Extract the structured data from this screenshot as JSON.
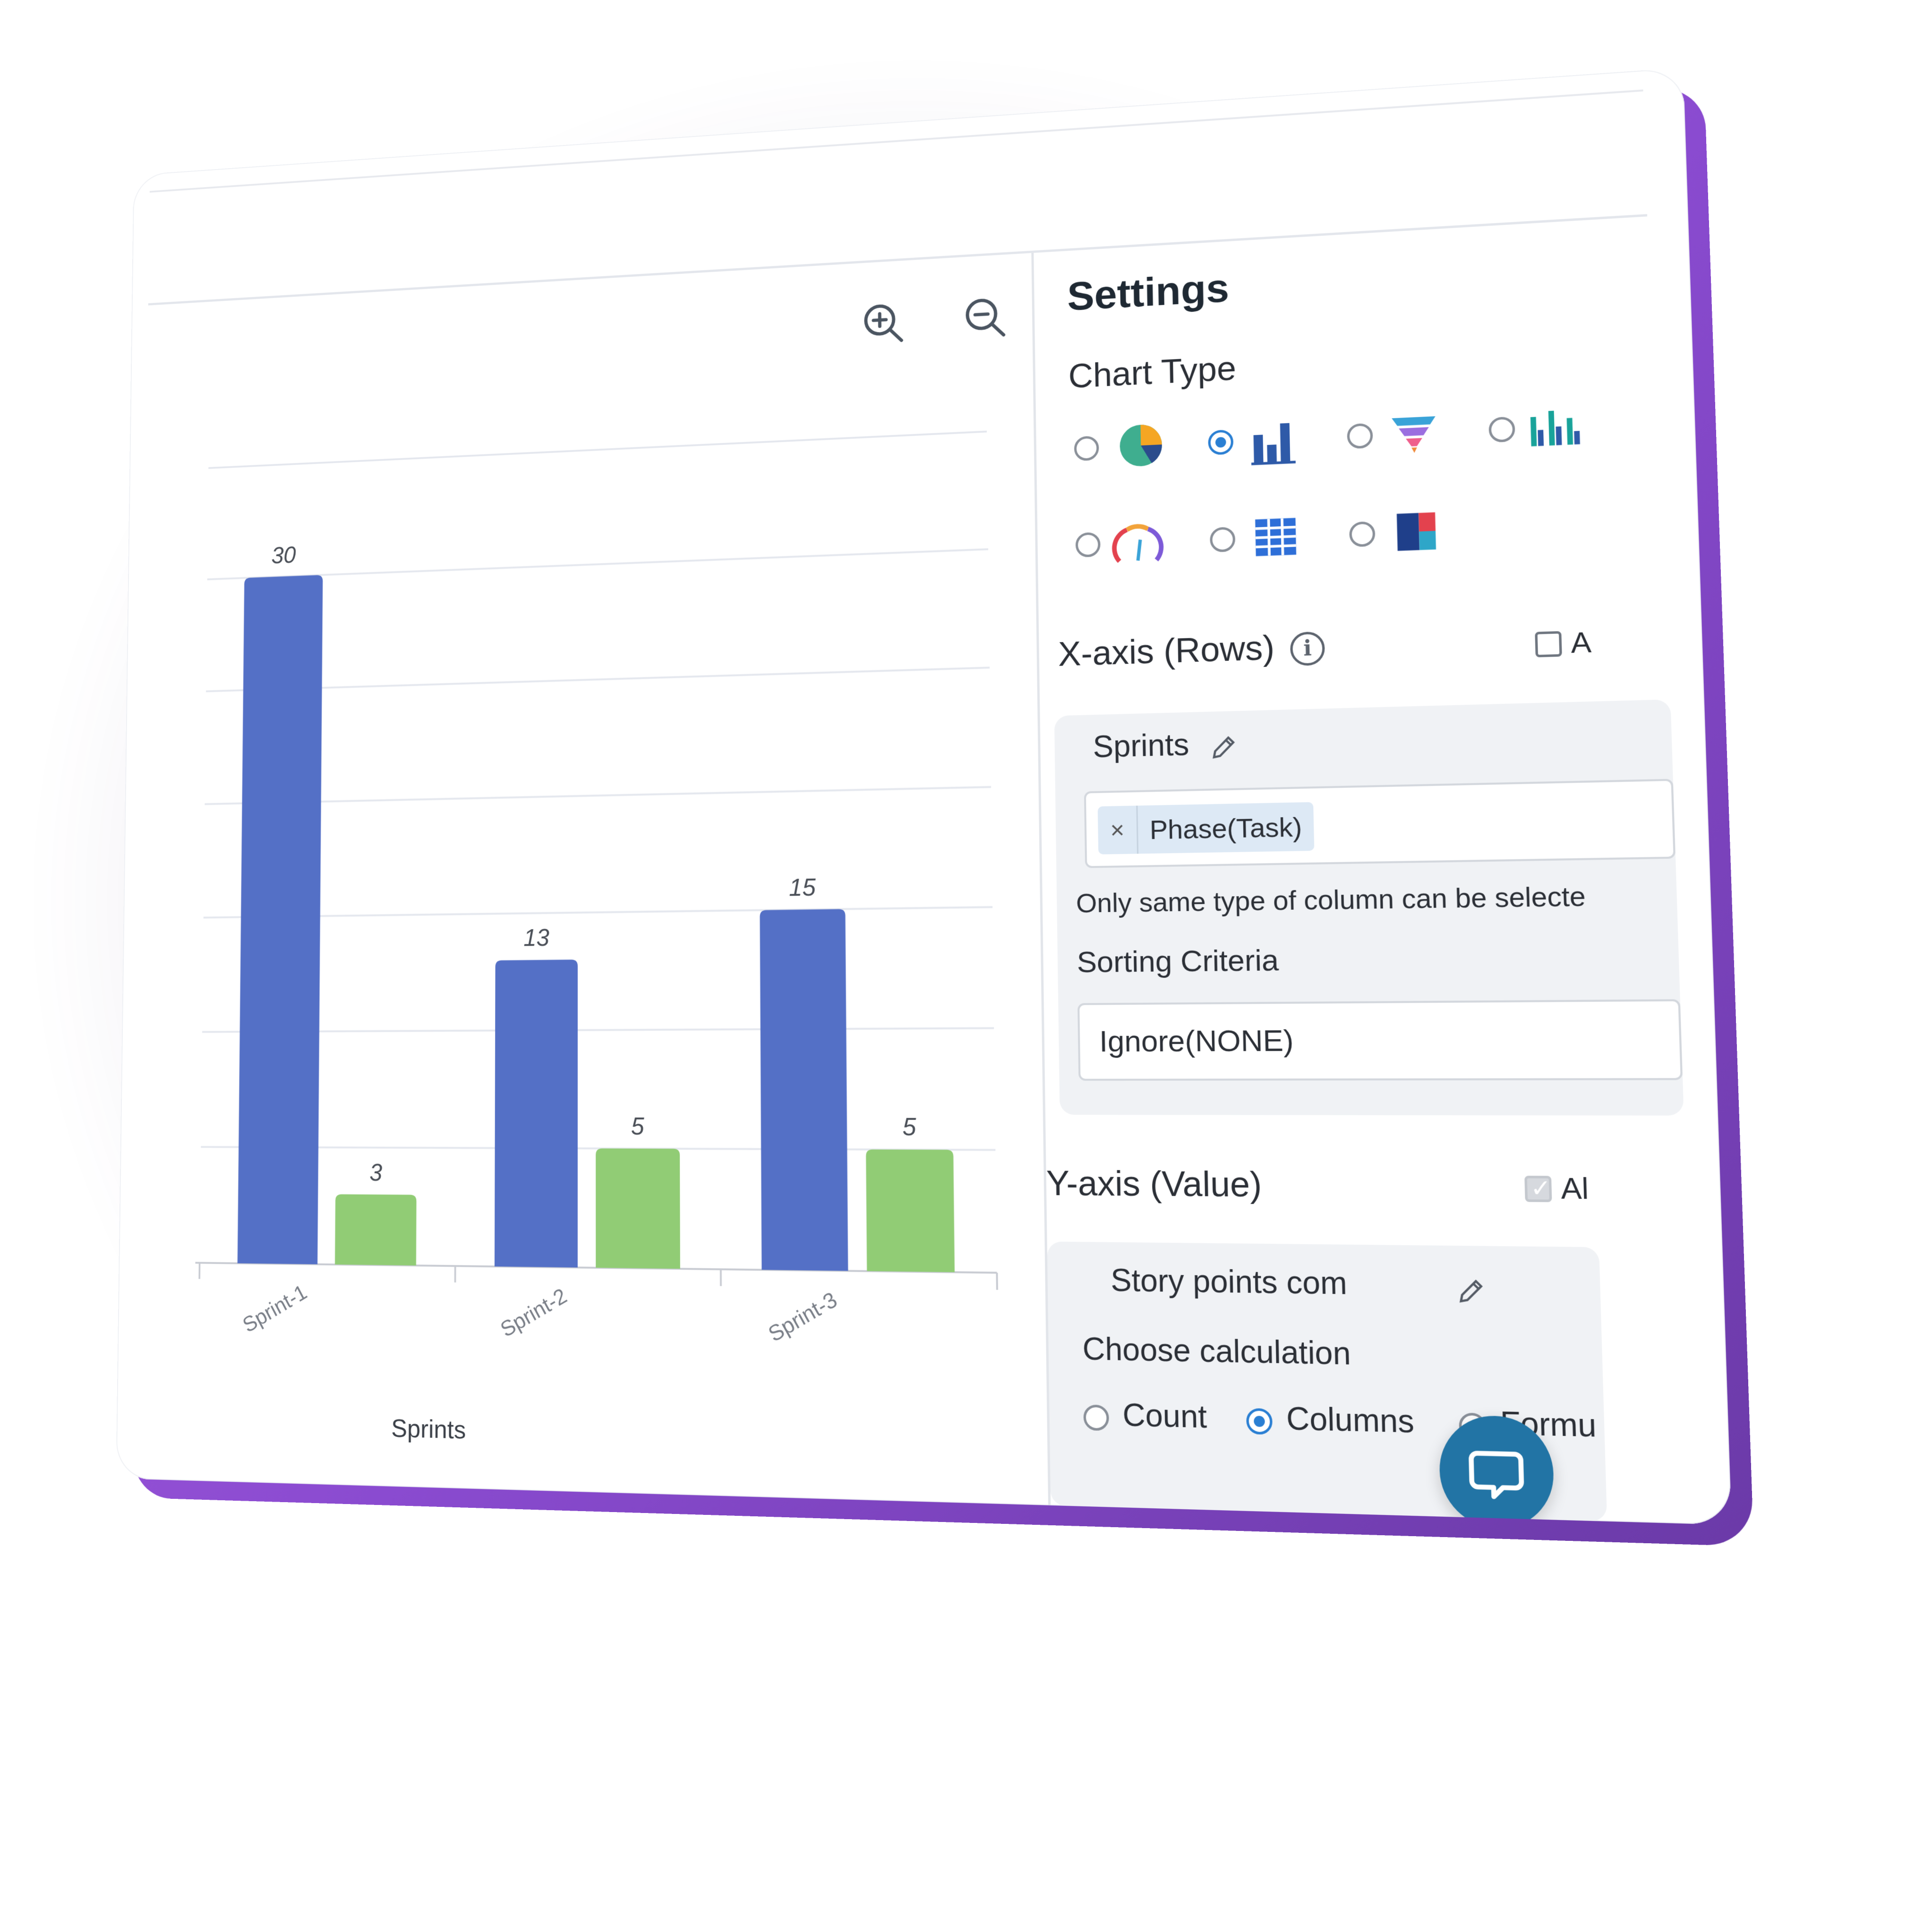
{
  "chart": {
    "zoom_in_icon": "zoom-in-icon",
    "zoom_out_icon": "zoom-out-icon"
  },
  "chart_data": {
    "type": "bar",
    "categories": [
      "Sprint-1",
      "Sprint-2",
      "Sprint-3"
    ],
    "series": [
      {
        "values": [
          30,
          13,
          15
        ],
        "color": "#5470c6"
      },
      {
        "values": [
          3,
          5,
          5
        ],
        "color": "#91cc75"
      }
    ],
    "xlabel": "Sprints",
    "ylabel": "",
    "ylim": [
      0,
      35
    ],
    "grid": true
  },
  "settings": {
    "title": "Settings",
    "chart_type_label": "Chart Type",
    "chart_types": [
      {
        "icon": "pie-chart-icon",
        "selected": false
      },
      {
        "icon": "bar-chart-icon",
        "selected": true
      },
      {
        "icon": "funnel-chart-icon",
        "selected": false
      },
      {
        "icon": "grouped-bar-chart-icon",
        "selected": false
      },
      {
        "icon": "gauge-chart-icon",
        "selected": false
      },
      {
        "icon": "table-chart-icon",
        "selected": false
      },
      {
        "icon": "treemap-chart-icon",
        "selected": false
      }
    ],
    "x_axis": {
      "label": "X-axis (Rows)",
      "checkbox_label": "A",
      "group_title": "Sprints",
      "chip": "Phase(Task)",
      "chip_remove": "×",
      "hint": "Only same type of column can be selecte",
      "sorting_label": "Sorting Criteria",
      "sorting_value": "Ignore(NONE)"
    },
    "y_axis": {
      "label": "Y-axis (Value)",
      "checkbox_label": "Al",
      "group_title": "Story points com",
      "calc_label": "Choose calculation",
      "options": [
        "Count",
        "Columns",
        "Formu"
      ],
      "selected": "Columns"
    }
  }
}
